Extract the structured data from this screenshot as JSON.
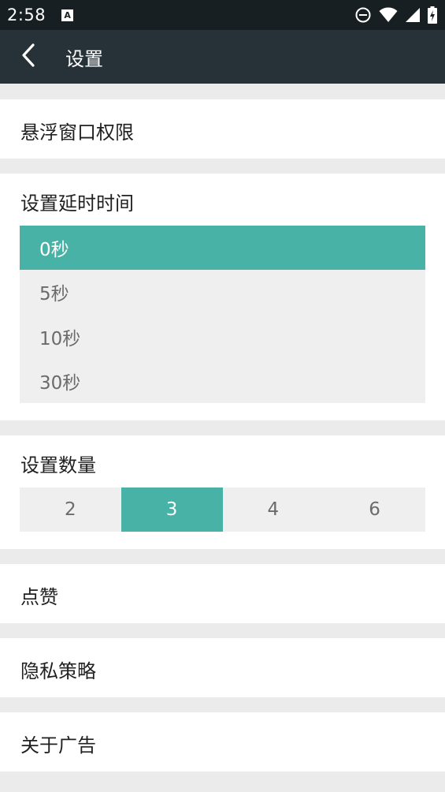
{
  "status_bar": {
    "time": "2:58",
    "notification_glyph": "A",
    "icons": [
      "do-not-disturb-icon",
      "wifi-icon",
      "signal-icon",
      "battery-charging-icon"
    ]
  },
  "app_bar": {
    "back_icon": "chevron-left-icon",
    "title": "设置"
  },
  "float_permission": {
    "label": "悬浮窗口权限"
  },
  "delay": {
    "label": "设置延时时间",
    "options": [
      "0秒",
      "5秒",
      "10秒",
      "30秒"
    ],
    "selected": "0秒"
  },
  "count": {
    "label": "设置数量",
    "options": [
      "2",
      "3",
      "4",
      "6"
    ],
    "selected": "3"
  },
  "like": {
    "label": "点赞"
  },
  "privacy": {
    "label": "隐私策略"
  },
  "about_ads": {
    "label": "关于广告"
  },
  "colors": {
    "status_bar": "#181f23",
    "app_bar": "#263238",
    "accent": "#49b2a7",
    "page_bg": "#ebebeb",
    "option_bg": "#efefef"
  }
}
